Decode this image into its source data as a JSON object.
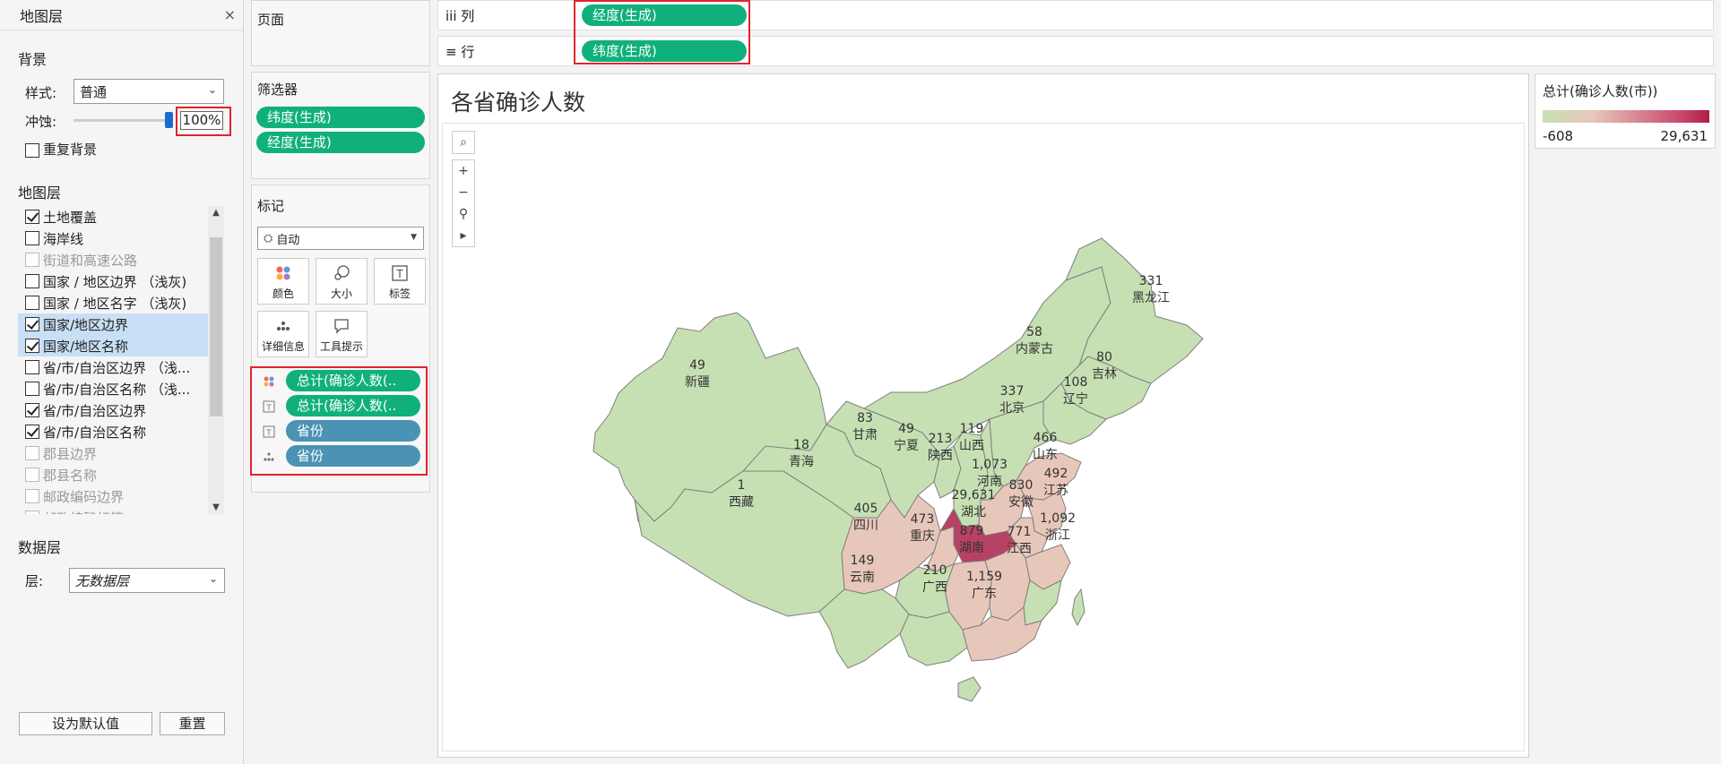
{
  "layers_panel": {
    "title": "地图层",
    "close": "×",
    "background": {
      "title": "背景",
      "style_label": "样式:",
      "style_value": "普通",
      "washout_label": "冲蚀:",
      "washout_value": "100%",
      "washout_level": 1.0,
      "repeat_label": "重复背景",
      "repeat_checked": false
    },
    "layers_title": "地图层",
    "layers": [
      {
        "label": "土地覆盖",
        "checked": true,
        "selected": false,
        "disabled": false
      },
      {
        "label": "海岸线",
        "checked": false,
        "selected": false,
        "disabled": false
      },
      {
        "label": "街道和高速公路",
        "checked": false,
        "selected": false,
        "disabled": true
      },
      {
        "label": "国家 / 地区边界 （浅灰)",
        "checked": false,
        "selected": false,
        "disabled": false
      },
      {
        "label": "国家 / 地区名字 （浅灰)",
        "checked": false,
        "selected": false,
        "disabled": false
      },
      {
        "label": "国家/地区边界",
        "checked": true,
        "selected": true,
        "disabled": false
      },
      {
        "label": "国家/地区名称",
        "checked": true,
        "selected": true,
        "disabled": false
      },
      {
        "label": "省/市/自治区边界 （浅...",
        "checked": false,
        "selected": false,
        "disabled": false
      },
      {
        "label": "省/市/自治区名称 （浅...",
        "checked": false,
        "selected": false,
        "disabled": false
      },
      {
        "label": "省/市/自治区边界",
        "checked": true,
        "selected": false,
        "disabled": false
      },
      {
        "label": "省/市/自治区名称",
        "checked": true,
        "selected": false,
        "disabled": false
      },
      {
        "label": "郡县边界",
        "checked": false,
        "selected": false,
        "disabled": true
      },
      {
        "label": "郡县名称",
        "checked": false,
        "selected": false,
        "disabled": true
      },
      {
        "label": "邮政编码边界",
        "checked": false,
        "selected": false,
        "disabled": true
      },
      {
        "label": "邮政编码标签",
        "checked": false,
        "selected": false,
        "disabled": true
      }
    ],
    "data_layer": {
      "title": "数据层",
      "layer_label": "层:",
      "layer_value": "无数据层"
    },
    "set_default_label": "设为默认值",
    "reset_label": "重置"
  },
  "pages": {
    "title": "页面"
  },
  "filters": {
    "title": "筛选器",
    "pills": [
      "纬度(生成)",
      "经度(生成)"
    ]
  },
  "marks": {
    "title": "标记",
    "type": "自动",
    "buttons": [
      {
        "label": "颜色",
        "icon": "color-icon"
      },
      {
        "label": "大小",
        "icon": "size-icon"
      },
      {
        "label": "标签",
        "icon": "label-icon"
      },
      {
        "label": "详细信息",
        "icon": "detail-icon"
      },
      {
        "label": "工具提示",
        "icon": "tooltip-icon"
      }
    ],
    "fields": [
      {
        "label": "总计(确诊人数(..",
        "kind": "color",
        "color": "green"
      },
      {
        "label": "总计(确诊人数(..",
        "kind": "label",
        "color": "green"
      },
      {
        "label": "省份",
        "kind": "label",
        "color": "blue"
      },
      {
        "label": "省份",
        "kind": "detail",
        "color": "blue"
      }
    ]
  },
  "columns_shelf": {
    "label": "iii 列",
    "pill": "经度(生成)"
  },
  "rows_shelf": {
    "label": "行",
    "pill": "纬度(生成)"
  },
  "view": {
    "title": "各省确诊人数",
    "tools": [
      "⌕",
      "+",
      "−",
      "⚲",
      "▸"
    ]
  },
  "legend": {
    "title": "总计(确诊人数(市))",
    "min": "-608",
    "max": "29,631",
    "colors": {
      "low": "#c6e0b4",
      "mid": "#e8c7bb",
      "high": "#b01c46"
    }
  },
  "map_labels": [
    {
      "value": "331",
      "name": "黑龙江"
    },
    {
      "value": "58",
      "name": "内蒙古"
    },
    {
      "value": "80",
      "name": "吉林"
    },
    {
      "value": "108",
      "name": "辽宁"
    },
    {
      "value": "337",
      "name": "北京"
    },
    {
      "value": "49",
      "name": "新疆"
    },
    {
      "value": "83",
      "name": "甘肃"
    },
    {
      "value": "49",
      "name": "宁夏"
    },
    {
      "value": "213",
      "name": "陕西"
    },
    {
      "value": "119",
      "name": "山西"
    },
    {
      "value": "466",
      "name": "山东"
    },
    {
      "value": "18",
      "name": "青海"
    },
    {
      "value": "1,073",
      "name": "河南"
    },
    {
      "value": "492",
      "name": "江苏"
    },
    {
      "value": "830",
      "name": "安徽"
    },
    {
      "value": "1",
      "name": "西藏"
    },
    {
      "value": "405",
      "name": "四川"
    },
    {
      "value": "473",
      "name": "重庆"
    },
    {
      "value": "29,631",
      "name": "湖北"
    },
    {
      "value": "1,092",
      "name": "浙江"
    },
    {
      "value": "879",
      "name": "湖南"
    },
    {
      "value": "771",
      "name": "江西"
    },
    {
      "value": "149",
      "name": "云南"
    },
    {
      "value": "210",
      "name": "广西"
    },
    {
      "value": "1,159",
      "name": "广东"
    }
  ]
}
